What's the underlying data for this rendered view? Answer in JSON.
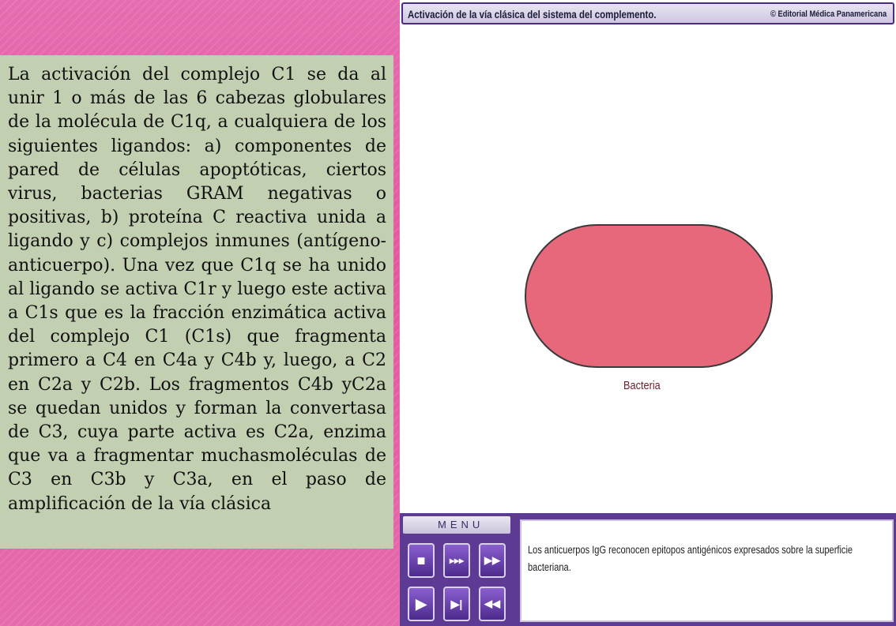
{
  "left_panel": {
    "paragraph": "La activación del complejo C1 se da al unir 1 o más de las 6 cabezas globulares de la molécula de C1q, a cualquiera de los siguientes ligandos: a) componentes de pared de células apoptóticas, ciertos virus, bacterias GRAM negativas o positivas, b) proteína C reactiva unida a ligando y c) complejos inmunes (antígeno-anticuerpo). Una vez que C1q se ha unido al ligando se activa C1r y luego este activa a C1s que es la fracción enzimática activa del complejo C1 (C1s) que fragmenta primero a C4 en C4a y C4b y, luego, a C2 en C2a y C2b. Los fragmentos C4b yC2a se quedan unidos y forman la convertasa de C3, cuya parte activa es C2a, enzima que va a fragmentar muchasmoléculas de C3 en C3b y C3a, en el paso de amplificación de la vía clásica"
  },
  "app": {
    "title": "Activación de la vía clásica del sistema del complemento.",
    "publisher": "© Editorial Médica Panamericana",
    "stage": {
      "bacteria_label": "Bacteria"
    },
    "menu": {
      "label": "MENU",
      "buttons": [
        {
          "name": "stop-button",
          "icon": "stop-icon",
          "glyph": "■"
        },
        {
          "name": "fast-forward-button",
          "icon": "fast-forward-icon",
          "glyph": "▸▸▸"
        },
        {
          "name": "next-button",
          "icon": "skip-forward-icon",
          "glyph": "▶▶"
        },
        {
          "name": "play-button",
          "icon": "play-icon",
          "glyph": "▶"
        },
        {
          "name": "step-forward-button",
          "icon": "step-forward-icon",
          "glyph": "▶|"
        },
        {
          "name": "rewind-button",
          "icon": "rewind-icon",
          "glyph": "◀◀"
        }
      ]
    },
    "caption": "Los anticuerpos IgG reconocen epitopos antigénicos expresados sobre la superficie bacteriana."
  },
  "colors": {
    "background_pink": "#e46fae",
    "text_panel": "#c3cfb1",
    "bacteria_fill": "#e8687b",
    "menu_purple": "#5d3a94"
  }
}
